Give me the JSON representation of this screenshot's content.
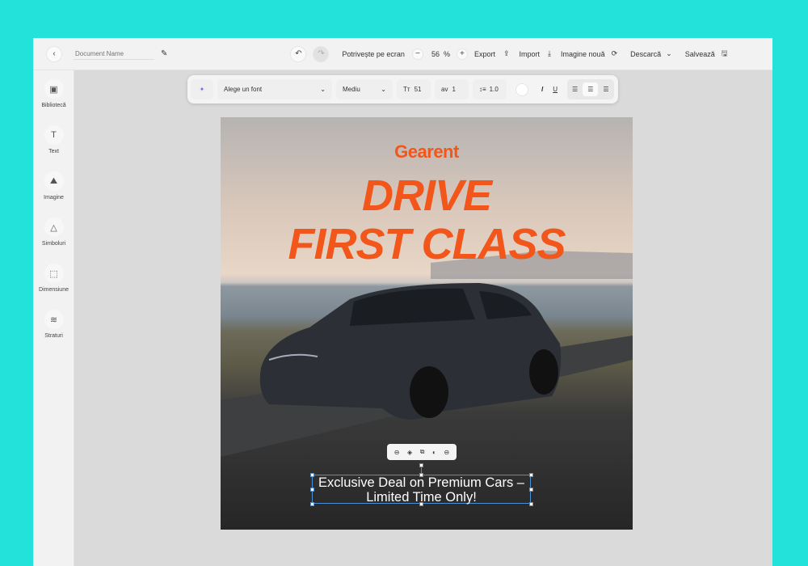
{
  "topbar": {
    "doc_placeholder": "Document Name",
    "fit": "Potrivește pe ecran",
    "zoom": "56",
    "zoom_unit": "%",
    "export": "Export",
    "import": "Import",
    "new_image": "Imagine nouă",
    "download": "Descarcă",
    "save": "Salvează"
  },
  "sidebar": {
    "items": [
      {
        "label": "Bibliotecă",
        "icon": "library-icon"
      },
      {
        "label": "Text",
        "icon": "text-icon"
      },
      {
        "label": "Imagine",
        "icon": "image-icon"
      },
      {
        "label": "Simboluri",
        "icon": "shapes-icon"
      },
      {
        "label": "Dimensiune",
        "icon": "resize-icon"
      },
      {
        "label": "Straturi",
        "icon": "layers-icon"
      }
    ]
  },
  "format": {
    "font": "Alege un font",
    "weight": "Mediu",
    "size": "51",
    "spacing": "1",
    "line_height": "1.0",
    "color": "#ffffff"
  },
  "artboard": {
    "brand": "Gearent",
    "line1": "DRIVE",
    "line2": "FIRST CLASS",
    "caption": "Exclusive Deal on Premium Cars – Limited Time Only!",
    "accent": "#f2561b"
  }
}
